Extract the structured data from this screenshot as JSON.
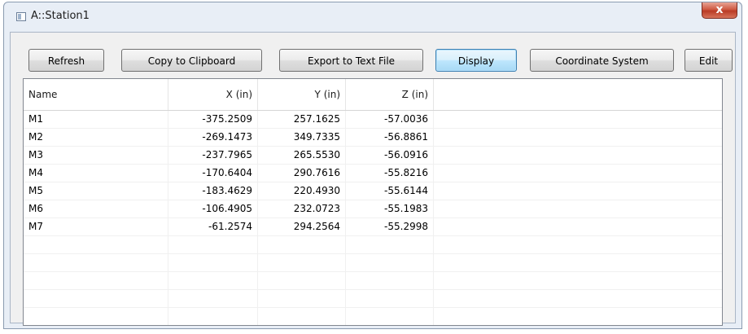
{
  "window": {
    "title": "A::Station1",
    "close_label": "x"
  },
  "toolbar": {
    "refresh": "Refresh",
    "copy": "Copy to Clipboard",
    "export": "Export to Text File",
    "display": "Display",
    "coordinate_system": "Coordinate System",
    "edit": "Edit"
  },
  "table": {
    "columns": [
      "Name",
      "X (in)",
      "Y (in)",
      "Z (in)"
    ],
    "rows": [
      [
        "M1",
        "-375.2509",
        "257.1625",
        "-57.0036"
      ],
      [
        "M2",
        "-269.1473",
        "349.7335",
        "-56.8861"
      ],
      [
        "M3",
        "-237.7965",
        "265.5530",
        "-56.0916"
      ],
      [
        "M4",
        "-170.6404",
        "290.7616",
        "-55.8216"
      ],
      [
        "M5",
        "-183.4629",
        "220.4930",
        "-55.6144"
      ],
      [
        "M6",
        "-106.4905",
        "232.0723",
        "-55.1983"
      ],
      [
        "M7",
        "-61.2574",
        "294.2564",
        "-55.2998"
      ]
    ]
  }
}
